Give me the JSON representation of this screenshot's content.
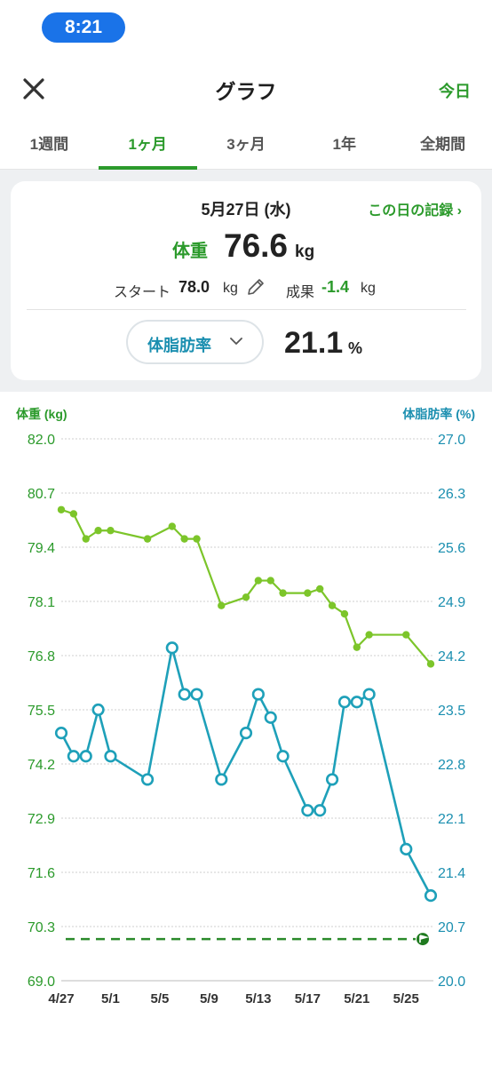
{
  "status": {
    "time": "8:21"
  },
  "nav": {
    "title": "グラフ",
    "today_label": "今日"
  },
  "tabs": [
    {
      "label": "1週間",
      "active": false
    },
    {
      "label": "1ヶ月",
      "active": true
    },
    {
      "label": "3ヶ月",
      "active": false
    },
    {
      "label": "1年",
      "active": false
    },
    {
      "label": "全期間",
      "active": false
    }
  ],
  "summary": {
    "date": "5月27日 (水)",
    "record_link": "この日の記録 ›",
    "weight_label": "体重",
    "weight_value": "76.6",
    "weight_unit": "kg",
    "start_label": "スタート",
    "start_value": "78.0",
    "start_unit": "kg",
    "result_label": "成果",
    "result_value": "-1.4",
    "result_unit": "kg",
    "metric_selector": "体脂肪率",
    "fat_value": "21.1",
    "fat_unit": "%"
  },
  "colors": {
    "accent": "#2b9a2b",
    "weight_line": "#7cc52a",
    "fat_line": "#1ea0b9",
    "weight_axis": "#2b9a2b",
    "fat_axis": "#1b8fb0"
  },
  "chart_data": {
    "type": "line",
    "left_axis_label": "体重 (kg)",
    "right_axis_label": "体脂肪率 (%)",
    "left_ticks": [
      "82.0",
      "80.7",
      "79.4",
      "78.1",
      "76.8",
      "75.5",
      "74.2",
      "72.9",
      "71.6",
      "70.3",
      "69.0"
    ],
    "right_ticks": [
      "27.0",
      "26.3",
      "25.6",
      "24.9",
      "24.2",
      "23.5",
      "22.8",
      "22.1",
      "21.4",
      "20.7",
      "20.0"
    ],
    "ylim_left": [
      69.0,
      82.0
    ],
    "ylim_right": [
      20.0,
      27.0
    ],
    "x_ticks": [
      "4/27",
      "5/1",
      "5/5",
      "5/9",
      "5/13",
      "5/17",
      "5/21",
      "5/25"
    ],
    "x_range_days": [
      0,
      30
    ],
    "target_weight": 70.0,
    "series": [
      {
        "name": "体重",
        "axis": "left",
        "points": [
          [
            0,
            80.3
          ],
          [
            1,
            80.2
          ],
          [
            2,
            79.6
          ],
          [
            3,
            79.8
          ],
          [
            4,
            79.8
          ],
          [
            7,
            79.6
          ],
          [
            9,
            79.9
          ],
          [
            10,
            79.6
          ],
          [
            11,
            79.6
          ],
          [
            13,
            78.0
          ],
          [
            15,
            78.2
          ],
          [
            16,
            78.6
          ],
          [
            17,
            78.6
          ],
          [
            18,
            78.3
          ],
          [
            20,
            78.3
          ],
          [
            21,
            78.4
          ],
          [
            22,
            78.0
          ],
          [
            23,
            77.8
          ],
          [
            24,
            77.0
          ],
          [
            25,
            77.3
          ],
          [
            28,
            77.3
          ],
          [
            30,
            76.6
          ]
        ]
      },
      {
        "name": "体脂肪率",
        "axis": "right",
        "points": [
          [
            0,
            23.2
          ],
          [
            1,
            22.9
          ],
          [
            2,
            22.9
          ],
          [
            3,
            23.5
          ],
          [
            4,
            22.9
          ],
          [
            7,
            22.6
          ],
          [
            9,
            24.3
          ],
          [
            10,
            23.7
          ],
          [
            11,
            23.7
          ],
          [
            13,
            22.6
          ],
          [
            15,
            23.2
          ],
          [
            16,
            23.7
          ],
          [
            17,
            23.4
          ],
          [
            18,
            22.9
          ],
          [
            20,
            22.2
          ],
          [
            21,
            22.2
          ],
          [
            22,
            22.6
          ],
          [
            23,
            23.6
          ],
          [
            24,
            23.6
          ],
          [
            25,
            23.7
          ],
          [
            28,
            21.7
          ],
          [
            30,
            21.1
          ]
        ]
      }
    ]
  }
}
